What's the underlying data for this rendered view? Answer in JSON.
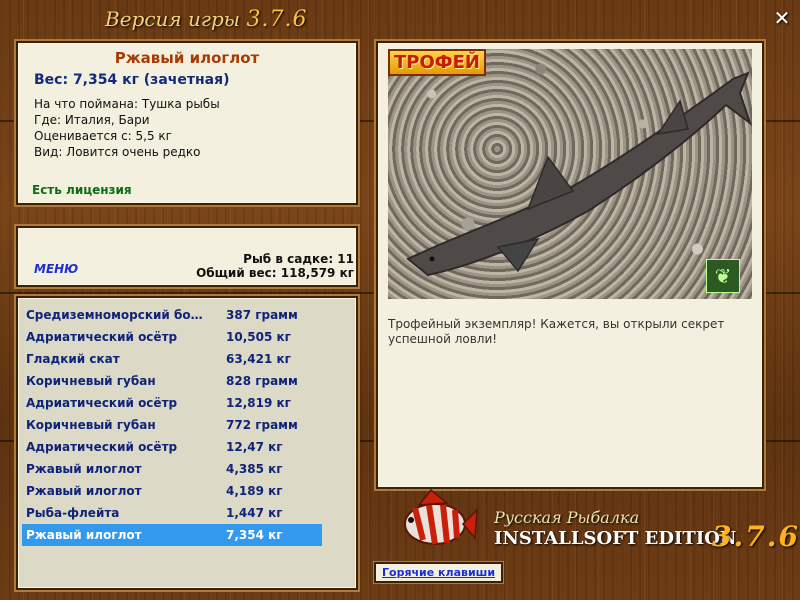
{
  "window": {
    "title_prefix": "Версия игры",
    "title_version": "3.7.6",
    "close_glyph": "✕"
  },
  "fish_info": {
    "name": "Ржавый илоглот",
    "weight_line": "Вес: 7,354 кг (зачетная)",
    "caught_with": "На что поймана: Тушка рыбы",
    "location": "Где: Италия, Бари",
    "rated_from": "Оценивается с: 5,5 кг",
    "kind": "Вид: Ловится очень редко",
    "license": "Есть лицензия"
  },
  "summary": {
    "menu_label": "МЕНЮ",
    "fish_in_cage": "Рыб в садке: 11",
    "total_weight": "Общий вес: 118,579 кг"
  },
  "catch_list": {
    "selected_index": 10,
    "rows": [
      {
        "name": "Средиземноморский бо…",
        "weight": "387 грамм"
      },
      {
        "name": "Адриатический осётр",
        "weight": "10,505 кг"
      },
      {
        "name": "Гладкий скат",
        "weight": "63,421 кг"
      },
      {
        "name": "Коричневый губан",
        "weight": "828 грамм"
      },
      {
        "name": "Адриатический осётр",
        "weight": "12,819 кг"
      },
      {
        "name": "Коричневый губан",
        "weight": "772 грамм"
      },
      {
        "name": "Адриатический осётр",
        "weight": "12,47 кг"
      },
      {
        "name": "Ржавый илоглот",
        "weight": "4,385 кг"
      },
      {
        "name": "Ржавый илоглот",
        "weight": "4,189 кг"
      },
      {
        "name": "Рыба-флейта",
        "weight": "1,447 кг"
      },
      {
        "name": "Ржавый илоглот",
        "weight": "7,354 кг"
      }
    ]
  },
  "trophy": {
    "badge_label": "ТРОФЕЙ",
    "description": "Трофейный экземпляр! Кажется, вы открыли секрет успешной ловли!",
    "butterfly_icon": "butterfly-icon"
  },
  "logo": {
    "line1": "Русская Рыбалка",
    "line2": "INSTALLSOFT EDITION",
    "version": "3.7.6"
  },
  "hotkeys_label": "Горячие клавиши",
  "colors": {
    "selected_row": "#3399ef",
    "fish_name": "#a83a06",
    "license": "#0a6e12",
    "link": "#1a2fd0"
  }
}
